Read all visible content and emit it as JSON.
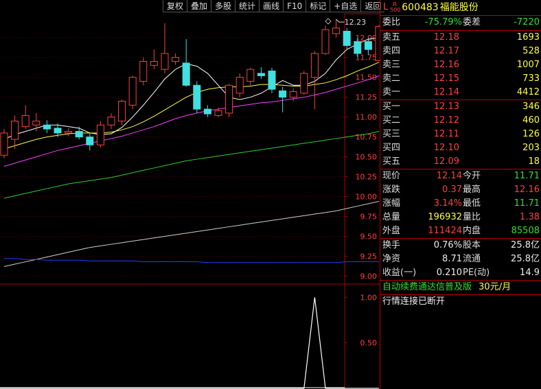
{
  "toolbar": {
    "buttons": [
      "复权",
      "叠加",
      "多股",
      "统计",
      "画线",
      "F10",
      "标记",
      "+自选",
      "返回"
    ]
  },
  "stock": {
    "prefix": "L",
    "badge_top": "R",
    "badge_bottom": "500",
    "code": "600483",
    "name": "福能股份"
  },
  "committee": {
    "ratio_label": "委比",
    "ratio_value": "-75.79%",
    "diff_label": "委差",
    "diff_value": "-7220"
  },
  "sell": [
    {
      "label": "卖五",
      "price": "12.18",
      "vol": "1693"
    },
    {
      "label": "卖四",
      "price": "12.17",
      "vol": "528"
    },
    {
      "label": "卖三",
      "price": "12.16",
      "vol": "1007"
    },
    {
      "label": "卖二",
      "price": "12.15",
      "vol": "733"
    },
    {
      "label": "卖一",
      "price": "12.14",
      "vol": "4412"
    }
  ],
  "buy": [
    {
      "label": "买一",
      "price": "12.13",
      "vol": "346"
    },
    {
      "label": "买二",
      "price": "12.12",
      "vol": "460"
    },
    {
      "label": "买三",
      "price": "12.11",
      "vol": "126"
    },
    {
      "label": "买四",
      "price": "12.10",
      "vol": "203"
    },
    {
      "label": "买五",
      "price": "12.09",
      "vol": "18"
    }
  ],
  "quote": [
    {
      "l1": "现价",
      "v1": "12.14",
      "c1": "red",
      "l2": "今开",
      "v2": "11.71",
      "c2": "grn"
    },
    {
      "l1": "涨跌",
      "v1": "0.37",
      "c1": "red",
      "l2": "最高",
      "v2": "12.16",
      "c2": "red"
    },
    {
      "l1": "涨幅",
      "v1": "3.14%",
      "c1": "red",
      "l2": "最低",
      "v2": "11.71",
      "c2": "grn"
    },
    {
      "l1": "总量",
      "v1": "196932",
      "c1": "yel",
      "l2": "量比",
      "v2": "1.38",
      "c2": "red"
    },
    {
      "l1": "外盘",
      "v1": "111424",
      "c1": "red",
      "l2": "内盘",
      "v2": "85508",
      "c2": "grn"
    }
  ],
  "fundamentals": [
    {
      "l1": "换手",
      "v1": "0.76%",
      "l2": "股本",
      "v2": "25.8亿"
    },
    {
      "l1": "净资",
      "v1": "8.71",
      "l2": "流通",
      "v2": "25.8亿"
    },
    {
      "l1": "收益(一)",
      "v1": "0.210",
      "l2": "PE(动)",
      "v2": "14.9"
    }
  ],
  "promo": {
    "text": "自动续费通达信普及版",
    "price": "30元/月"
  },
  "status": "行情连接已断开",
  "colors": {
    "up": "#ff4040",
    "down": "#40e0e0",
    "ma5": "#ffffff",
    "ma10": "#ffff40",
    "ma20": "#ff40ff",
    "ma60": "#30d030",
    "ma120": "#d0d0d0",
    "ma250": "#2040ff",
    "panel_border": "#b00000"
  },
  "chart_data": {
    "type": "candlestick",
    "y_ticks": [
      "12.00",
      "11.75",
      "11.50",
      "11.25",
      "11.00",
      "10.75",
      "10.50",
      "10.25",
      "10.00",
      "9.75",
      "9.50",
      "9.25",
      "9.00"
    ],
    "ylim": [
      8.9,
      12.3
    ],
    "max_label": "12.23",
    "candles": [
      {
        "o": 10.52,
        "c": 10.8,
        "h": 10.85,
        "l": 10.48
      },
      {
        "o": 10.72,
        "c": 10.95,
        "h": 11.02,
        "l": 10.6
      },
      {
        "o": 10.88,
        "c": 11.02,
        "h": 11.15,
        "l": 10.85
      },
      {
        "o": 10.9,
        "c": 10.95,
        "h": 11.05,
        "l": 10.82
      },
      {
        "o": 10.9,
        "c": 10.85,
        "h": 10.96,
        "l": 10.8
      },
      {
        "o": 10.86,
        "c": 10.8,
        "h": 10.92,
        "l": 10.75
      },
      {
        "o": 10.8,
        "c": 10.82,
        "h": 10.86,
        "l": 10.76
      },
      {
        "o": 10.82,
        "c": 10.75,
        "h": 10.88,
        "l": 10.72
      },
      {
        "o": 10.75,
        "c": 10.65,
        "h": 10.8,
        "l": 10.58
      },
      {
        "o": 10.65,
        "c": 10.9,
        "h": 10.95,
        "l": 10.62
      },
      {
        "o": 10.9,
        "c": 11.0,
        "h": 11.05,
        "l": 10.85
      },
      {
        "o": 10.95,
        "c": 11.2,
        "h": 11.22,
        "l": 10.9
      },
      {
        "o": 11.15,
        "c": 11.5,
        "h": 11.52,
        "l": 11.1
      },
      {
        "o": 11.45,
        "c": 11.7,
        "h": 11.75,
        "l": 11.4
      },
      {
        "o": 11.65,
        "c": 11.7,
        "h": 11.85,
        "l": 11.6
      },
      {
        "o": 11.6,
        "c": 11.8,
        "h": 12.18,
        "l": 11.55
      },
      {
        "o": 11.7,
        "c": 11.75,
        "h": 11.8,
        "l": 11.66
      },
      {
        "o": 11.68,
        "c": 11.4,
        "h": 11.98,
        "l": 11.38
      },
      {
        "o": 11.4,
        "c": 11.1,
        "h": 11.45,
        "l": 11.05
      },
      {
        "o": 11.1,
        "c": 11.04,
        "h": 11.15,
        "l": 11.0
      },
      {
        "o": 11.02,
        "c": 11.08,
        "h": 11.12,
        "l": 11.0
      },
      {
        "o": 11.05,
        "c": 11.4,
        "h": 11.42,
        "l": 11.0
      },
      {
        "o": 11.3,
        "c": 11.5,
        "h": 11.55,
        "l": 11.25
      },
      {
        "o": 11.45,
        "c": 11.6,
        "h": 11.62,
        "l": 11.4
      },
      {
        "o": 11.55,
        "c": 11.52,
        "h": 11.63,
        "l": 11.48
      },
      {
        "o": 11.58,
        "c": 11.35,
        "h": 11.62,
        "l": 11.3
      },
      {
        "o": 11.33,
        "c": 11.25,
        "h": 11.38,
        "l": 11.06
      },
      {
        "o": 11.25,
        "c": 11.32,
        "h": 11.36,
        "l": 11.2
      },
      {
        "o": 11.3,
        "c": 11.55,
        "h": 11.58,
        "l": 11.28
      },
      {
        "o": 11.5,
        "c": 11.8,
        "h": 11.83,
        "l": 11.1
      },
      {
        "o": 11.8,
        "c": 12.1,
        "h": 12.15,
        "l": 11.78
      },
      {
        "o": 12.05,
        "c": 12.12,
        "h": 12.23,
        "l": 12.0
      },
      {
        "o": 12.08,
        "c": 11.9,
        "h": 12.12,
        "l": 11.85
      },
      {
        "o": 11.95,
        "c": 11.8,
        "h": 12.0,
        "l": 11.75
      },
      {
        "o": 11.95,
        "c": 11.85,
        "h": 12.0,
        "l": 11.78
      },
      {
        "o": 11.71,
        "c": 12.14,
        "h": 12.16,
        "l": 11.71
      }
    ],
    "ma_series": [
      {
        "key": "ma5",
        "values": [
          10.72,
          10.78,
          10.82,
          10.86,
          10.9,
          10.9,
          10.88,
          10.86,
          10.8,
          10.78,
          10.79,
          10.87,
          11.0,
          11.15,
          11.31,
          11.48,
          11.6,
          11.67,
          11.64,
          11.55,
          11.4,
          11.25,
          11.22,
          11.25,
          11.3,
          11.38,
          11.46,
          11.4,
          11.4,
          11.45,
          11.55,
          11.72,
          11.85,
          11.92,
          11.98,
          12.0
        ]
      },
      {
        "key": "ma10",
        "values": [
          10.6,
          10.64,
          10.68,
          10.72,
          10.75,
          10.77,
          10.79,
          10.8,
          10.8,
          10.8,
          10.81,
          10.84,
          10.88,
          10.94,
          11.01,
          11.09,
          11.17,
          11.25,
          11.31,
          11.35,
          11.37,
          11.38,
          11.38,
          11.39,
          11.41,
          11.41,
          11.4,
          11.39,
          11.39,
          11.41,
          11.43,
          11.47,
          11.52,
          11.58,
          11.63,
          11.69
        ]
      },
      {
        "key": "ma20",
        "values": [
          10.38,
          10.42,
          10.46,
          10.5,
          10.54,
          10.58,
          10.61,
          10.64,
          10.67,
          10.7,
          10.73,
          10.76,
          10.8,
          10.84,
          10.88,
          10.93,
          10.98,
          11.02,
          11.05,
          11.08,
          11.1,
          11.12,
          11.14,
          11.16,
          11.18,
          11.19,
          11.21,
          11.23,
          11.25,
          11.28,
          11.31,
          11.35,
          11.39,
          11.43,
          11.47,
          11.52
        ]
      },
      {
        "key": "ma60",
        "values": [
          9.98,
          10.01,
          10.04,
          10.07,
          10.1,
          10.13,
          10.16,
          10.18,
          10.2,
          10.22,
          10.24,
          10.27,
          10.3,
          10.33,
          10.36,
          10.39,
          10.42,
          10.45,
          10.47,
          10.49,
          10.51,
          10.53,
          10.55,
          10.57,
          10.59,
          10.61,
          10.63,
          10.65,
          10.67,
          10.69,
          10.71,
          10.73,
          10.75,
          10.77,
          10.79,
          10.82
        ]
      },
      {
        "key": "ma120",
        "values": [
          9.12,
          9.15,
          9.18,
          9.21,
          9.24,
          9.27,
          9.3,
          9.33,
          9.36,
          9.38,
          9.4,
          9.42,
          9.44,
          9.46,
          9.48,
          9.5,
          9.52,
          9.54,
          9.56,
          9.58,
          9.6,
          9.62,
          9.64,
          9.66,
          9.68,
          9.7,
          9.72,
          9.74,
          9.76,
          9.78,
          9.8,
          9.82,
          9.85,
          9.88,
          9.91,
          9.94
        ]
      },
      {
        "key": "ma250",
        "values": [
          9.22,
          9.22,
          9.21,
          9.21,
          9.2,
          9.2,
          9.2,
          9.2,
          9.19,
          9.19,
          9.19,
          9.19,
          9.19,
          9.18,
          9.18,
          9.18,
          9.18,
          9.18,
          9.18,
          9.17,
          9.17,
          9.17,
          9.17,
          9.17,
          9.17,
          9.17,
          9.17,
          9.17,
          9.17,
          9.17,
          9.17,
          9.17,
          9.18,
          9.18,
          9.18,
          9.18
        ]
      }
    ],
    "indicator": {
      "y_ticks": [
        "1.00",
        "0.50"
      ],
      "ylim": [
        0,
        1.1
      ],
      "values": [
        0,
        0,
        0,
        0,
        0,
        0,
        0,
        0,
        0,
        0,
        0,
        0,
        0,
        0,
        0,
        0,
        0,
        0,
        0,
        0,
        0,
        0,
        0,
        0,
        0,
        0,
        0,
        0,
        0,
        1.0,
        0,
        0,
        0,
        0,
        0,
        0
      ]
    }
  }
}
